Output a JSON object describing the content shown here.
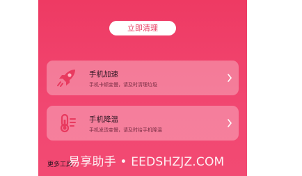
{
  "clean_button": {
    "label": "立即清理"
  },
  "features": [
    {
      "title": "手机加速",
      "subtitle": "手机卡顿变慢，请及时清理垃圾",
      "icon": "rocket-icon"
    },
    {
      "title": "手机降温",
      "subtitle": "手机发烫变慢，请及时给手机降温",
      "icon": "thermometer-icon"
    }
  ],
  "more_tools": {
    "label": "更多工具"
  },
  "watermark": {
    "text": "易享助手 • EEDSHZJZ.COM"
  },
  "colors": {
    "background": "#f14771",
    "accent_icon": "#e83a5f",
    "card": "rgba(255,255,255,0.30)"
  }
}
